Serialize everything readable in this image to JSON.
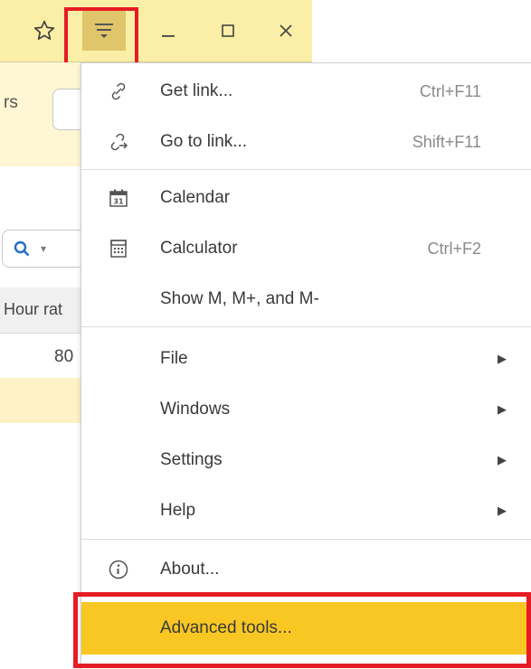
{
  "titlebar": {
    "icons": {
      "star": "star-outline-icon",
      "menu": "main-menu-icon",
      "minimize": "minimize-icon",
      "maximize": "maximize-icon",
      "close": "close-icon"
    },
    "background_color": "#fbeea6",
    "menu_active_color": "#e0c66a"
  },
  "background_app": {
    "label_fragment": "rs",
    "column_header": "Hour rat",
    "cell_value": "80",
    "search_icon": "search-icon"
  },
  "menu": {
    "items": [
      {
        "label": "Get link...",
        "shortcut": "Ctrl+F11",
        "icon": "link-icon"
      },
      {
        "label": "Go to link...",
        "shortcut": "Shift+F11",
        "icon": "go-to-link-icon"
      },
      {
        "label": "Calendar",
        "shortcut": "",
        "icon": "calendar-icon",
        "calendar_day": "31"
      },
      {
        "label": "Calculator",
        "shortcut": "Ctrl+F2",
        "icon": "calculator-icon"
      },
      {
        "label": "Show M, M+, and M-",
        "shortcut": ""
      },
      {
        "label": "File",
        "submenu": true
      },
      {
        "label": "Windows",
        "submenu": true
      },
      {
        "label": "Settings",
        "submenu": true
      },
      {
        "label": "Help",
        "submenu": true
      },
      {
        "label": "About...",
        "icon": "info-icon"
      },
      {
        "label": "Advanced tools...",
        "highlighted": true
      }
    ],
    "highlight_color": "#f8c723",
    "annotation_color": "#e51c23"
  }
}
